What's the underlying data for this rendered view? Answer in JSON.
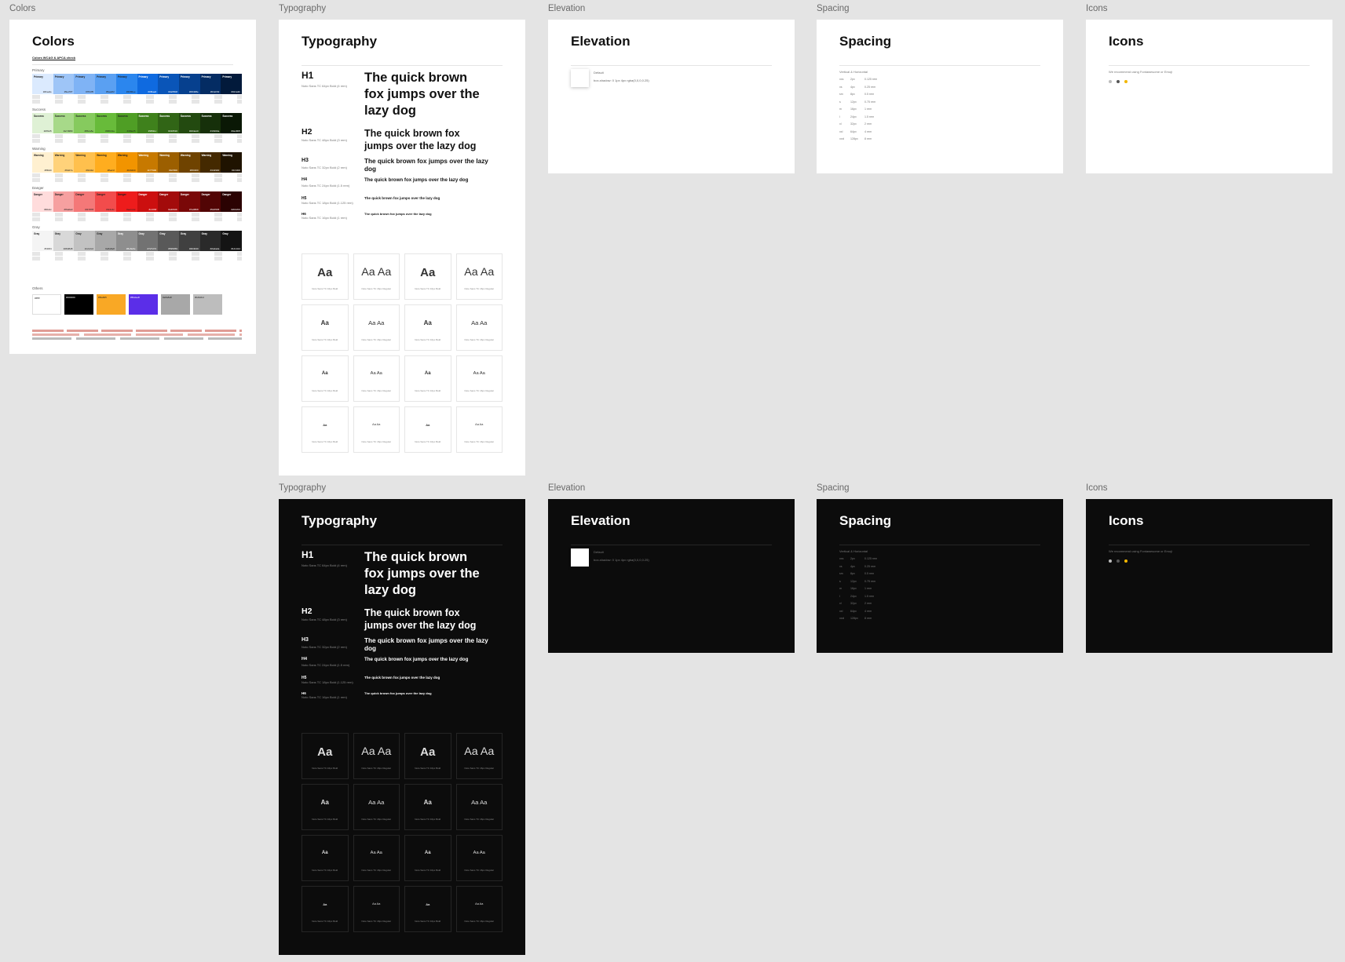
{
  "labels": {
    "colors": "Colors",
    "typo_light": "Typography",
    "elev_light": "Elevation",
    "space_light": "Spacing",
    "icons_light": "Icons",
    "typo_dark": "Typography",
    "elev_dark": "Elevation",
    "space_dark": "Spacing",
    "icons_dark": "Icons"
  },
  "colors_frame": {
    "title": "Colors",
    "subtitle": "Colors WCAG & APCA check",
    "groups": [
      {
        "name": "Primary",
        "colors": [
          "#dbeafe",
          "#9ec5f7",
          "#7fb3f5",
          "#5aa0f2",
          "#2b86ee",
          "#0f6ae0",
          "#0a55b8",
          "#06408e",
          "#042c63",
          "#021a3b"
        ]
      },
      {
        "name": "Success",
        "colors": [
          "#dff1d5",
          "#a7d989",
          "#86ca5e",
          "#68bb3a",
          "#4f9e25",
          "#3f811c",
          "#316516",
          "#234a10",
          "#16300a",
          "#0a1805"
        ]
      },
      {
        "name": "Warning",
        "colors": [
          "#fff0d0",
          "#ffd27a",
          "#ffc04d",
          "#ffad1f",
          "#f29400",
          "#c77900",
          "#9c5f00",
          "#6f4300",
          "#442900",
          "#1f1300"
        ]
      },
      {
        "name": "Danger",
        "colors": [
          "#ffdcdc",
          "#f6a0a0",
          "#f47878",
          "#f24c4c",
          "#ee1c1c",
          "#cc0f0f",
          "#a30b0b",
          "#7a0808",
          "#520505",
          "#2b0202"
        ]
      },
      {
        "name": "Gray",
        "colors": [
          "#f4f4f4",
          "#d8d8d8",
          "#c2c2c2",
          "#a8a8a8",
          "#8e8e8e",
          "#727272",
          "#595959",
          "#404040",
          "#2a2a2a",
          "#141414"
        ]
      }
    ],
    "others_label": "Others",
    "others": [
      "#ffffff",
      "#000000",
      "#f9a825",
      "#5b2ee8",
      "#a8a8a8",
      "#bdbdbd"
    ]
  },
  "typography": {
    "title": "Typography",
    "headings": [
      {
        "label": "H1",
        "meta": "Noto Sans TC 64px Bold (4 rem)",
        "sample": "The quick brown fox jumps over the lazy dog"
      },
      {
        "label": "H2",
        "meta": "Noto Sans TC 48px Bold (3 rem)",
        "sample": "The quick brown fox jumps over the lazy dog"
      },
      {
        "label": "H3",
        "meta": "Noto Sans TC 32px Bold (2 rem)",
        "sample": "The quick brown fox jumps over the lazy dog"
      },
      {
        "label": "H4",
        "meta": "Noto Sans TC 24px Bold (1.5 rem)",
        "sample": "The quick brown fox jumps over the lazy dog"
      },
      {
        "label": "H5",
        "meta": "Noto Sans TC 18px Bold (1.125 rem)",
        "sample": "The quick brown fox jumps over the lazy dog"
      },
      {
        "label": "H6",
        "meta": "Noto Sans TC 16px Bold (1 rem)",
        "sample": "The quick brown fox jumps over the lazy dog"
      }
    ],
    "card_glyph": "Aa",
    "card_glyph_pair": "Aa Aa",
    "card_meta_bold": "Noto Sans TC 16px Bold",
    "card_meta_regular": "Noto Sans TC 16px Regular"
  },
  "elevation": {
    "title": "Elevation",
    "item_name": "Default",
    "item_desc": "box-shadow: 0 1px 4px rgba(0,0,0,0.25)"
  },
  "spacing": {
    "title": "Spacing",
    "head": "Vertical & Horizontal",
    "rows": [
      {
        "name": "xxs",
        "px": "2px",
        "rem": "0.125 rem"
      },
      {
        "name": "xs",
        "px": "4px",
        "rem": "0.25 rem"
      },
      {
        "name": "sm",
        "px": "8px",
        "rem": "0.5 rem"
      },
      {
        "name": "s",
        "px": "12px",
        "rem": "0.75 rem"
      },
      {
        "name": "m",
        "px": "16px",
        "rem": "1 rem"
      },
      {
        "name": "l",
        "px": "24px",
        "rem": "1.5 rem"
      },
      {
        "name": "xl",
        "px": "32px",
        "rem": "2 rem"
      },
      {
        "name": "xxl",
        "px": "64px",
        "rem": "4 rem"
      },
      {
        "name": "xxxl",
        "px": "128px",
        "rem": "8 rem"
      }
    ]
  },
  "icons": {
    "title": "Icons",
    "text": "We recommend using Fontawesome or Emoji",
    "dots": [
      "#bdbdbd",
      "#555555",
      "#f2b600"
    ]
  }
}
